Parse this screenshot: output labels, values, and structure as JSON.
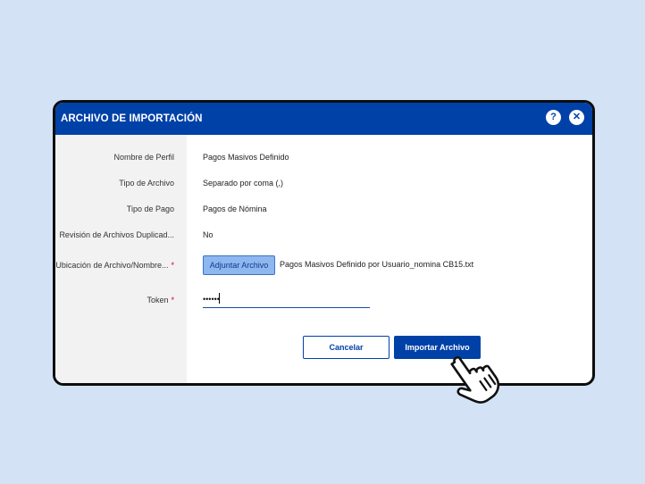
{
  "dialog": {
    "title": "ARCHIVO DE IMPORTACIÓN",
    "help_icon": "?",
    "close_icon": "✕"
  },
  "form": {
    "profile_name": {
      "label": "Nombre de Perfil",
      "value": "Pagos Masivos Definido"
    },
    "file_type": {
      "label": "Tipo de Archivo",
      "value": "Separado por coma (,)"
    },
    "payment_type": {
      "label": "Tipo de Pago",
      "value": "Pagos de Nómina"
    },
    "duplicate_review": {
      "label": "Revisión de Archivos Duplicad...",
      "value": "No"
    },
    "file_location": {
      "label": "Ubicación de Archivo/Nombre...",
      "required_mark": "*",
      "attach_label": "Adjuntar Archivo",
      "file_name": "Pagos Masivos Definido por Usuario_nomina CB15.txt"
    },
    "token": {
      "label": "Token",
      "required_mark": "*",
      "value": "••••••"
    }
  },
  "actions": {
    "cancel_label": "Cancelar",
    "import_label": "Importar Archivo"
  },
  "colors": {
    "primary": "#0041a8",
    "background": "#d3e3f5",
    "required": "#d0021b",
    "attach_button": "#8db7ee"
  },
  "icons": {
    "help": "help-icon",
    "close": "close-icon",
    "cursor": "hand-pointer-icon"
  }
}
